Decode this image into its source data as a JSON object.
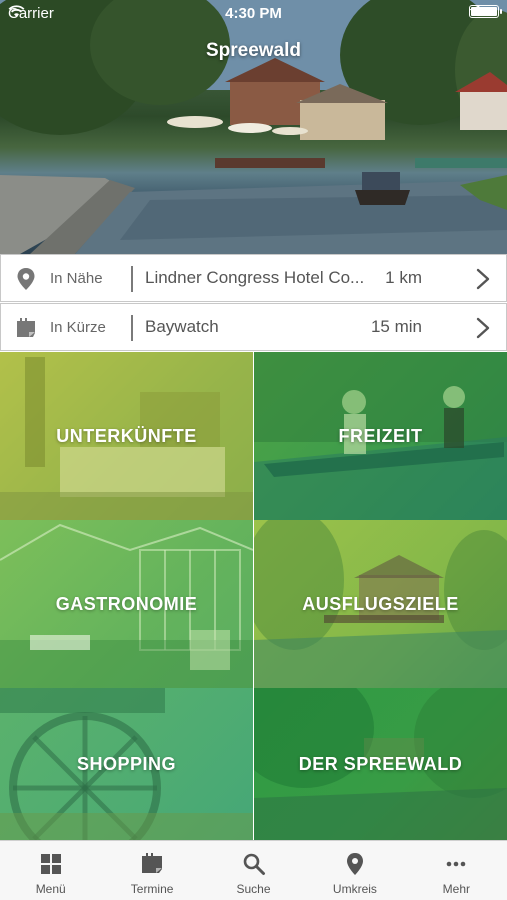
{
  "status_bar": {
    "carrier": "Carrier",
    "time": "4:30 PM"
  },
  "header": {
    "title": "Spreewald"
  },
  "rows": [
    {
      "icon": "location-pin-icon",
      "label": "In Nähe",
      "value": "Lindner Congress Hotel Co...",
      "distance": "1 km"
    },
    {
      "icon": "calendar-icon",
      "label": "In Kürze",
      "value": "Baywatch",
      "distance": "15 min"
    }
  ],
  "tiles": [
    {
      "label": "UNTERKÜNFTE"
    },
    {
      "label": "FREIZEIT"
    },
    {
      "label": "GASTRONOMIE"
    },
    {
      "label": "AUSFLUGSZIELE"
    },
    {
      "label": "SHOPPING"
    },
    {
      "label": "DER SPREEWALD"
    }
  ],
  "tabbar": [
    {
      "icon": "grid-icon",
      "label": "Menü"
    },
    {
      "icon": "calendar-icon",
      "label": "Termine"
    },
    {
      "icon": "search-icon",
      "label": "Suche"
    },
    {
      "icon": "location-pin-icon",
      "label": "Umkreis"
    },
    {
      "icon": "more-dots-icon",
      "label": "Mehr"
    }
  ],
  "colors": {
    "tab_icon": "#555555",
    "row_icon": "#777777"
  }
}
